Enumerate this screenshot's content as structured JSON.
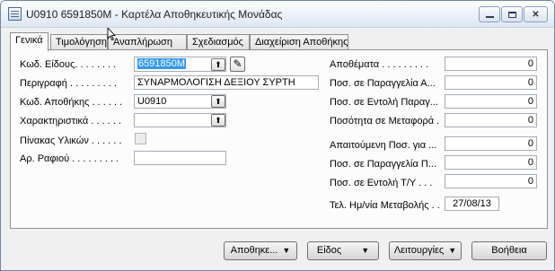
{
  "window": {
    "title": "U0910 6591850M - Καρτέλα Αποθηκευτικής Μονάδας",
    "controls": {
      "minimize": "minimize-icon",
      "maximize": "maximize-icon",
      "close": "✕"
    }
  },
  "tabs": [
    {
      "label": "Γενικά",
      "active": true
    },
    {
      "label": "Τιμολόγηση",
      "active": false
    },
    {
      "label": "Αναπλήρωση",
      "active": false
    },
    {
      "label": "Σχεδιασμός",
      "active": false
    },
    {
      "label": "Διαχείριση Αποθήκης",
      "active": false
    }
  ],
  "left_fields": {
    "item_code": {
      "label": "Κωδ. Είδους. . . . . . . .",
      "value": "6591850M"
    },
    "description": {
      "label": "Περιγραφή . . . . . . . . .",
      "value": "ΣΥΝΑΡΜΟΛΟΓΙΣΗ ΔΕΞΙΟΥ ΣΥΡΤΗ"
    },
    "warehouse_code": {
      "label": "Κωδ. Αποθήκης . . . . . .",
      "value": "U0910"
    },
    "characteristics": {
      "label": "Χαρακτηριστικά . . . . . .",
      "value": ""
    },
    "bom": {
      "label": "Πίνακας Υλικών . . . . . .",
      "value": ""
    },
    "shelf_no": {
      "label": "Αρ. Ραφιού . . . . . . . . .",
      "value": ""
    }
  },
  "right_fields": [
    {
      "label": "Αποθέματα . . . . . . . . .",
      "value": "0"
    },
    {
      "label": "Ποσ. σε Παραγγελία Α...",
      "value": "0"
    },
    {
      "label": "Ποσ. σε Εντολή Παραγ...",
      "value": "0"
    },
    {
      "label": "Ποσότητα σε Μεταφορά .",
      "value": "0"
    },
    {
      "label": "Απαιτούμενη Ποσ. για ...",
      "value": "0"
    },
    {
      "label": "Ποσ. σε Παραγγελία Π...",
      "value": "0"
    },
    {
      "label": "Ποσ. σε Εντολή Τ/Υ . . .",
      "value": "0"
    }
  ],
  "last_modified": {
    "label": "Τελ. Ημ/νία Μεταβολής . .",
    "value": "27/08/13"
  },
  "buttons": {
    "warehouse": "Αποθηκε...",
    "item": "Είδος",
    "functions": "Λειτουργίες",
    "help": "Βοήθεια"
  },
  "icons": {
    "lookup": "lookup-arrow-icon",
    "edit": "pencil-icon",
    "dropdown": "▼"
  }
}
